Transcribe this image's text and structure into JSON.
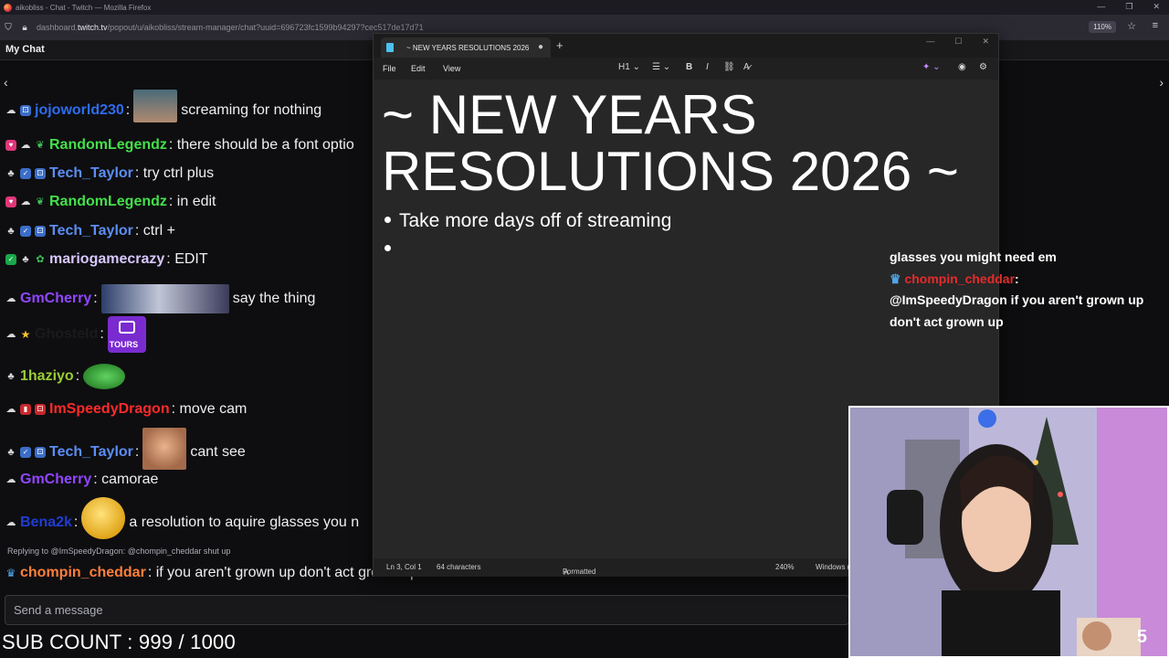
{
  "browser": {
    "window_title": "aikobliss - Chat - Twitch — Mozilla Firefox",
    "url_prefix": "dashboard.",
    "url_domain": "twitch.tv",
    "url_rest": "/popout/u/aikobliss/stream-manager/chat?uuid=696723fc1599b94297?cec517de17d71",
    "zoom": "110%"
  },
  "chat": {
    "header_title": "My Chat",
    "messages": [
      {
        "user": "jojoworld230",
        "color": "#2e6df0",
        "sep": ":",
        "text": "screaming for nothing"
      },
      {
        "user": "RandomLegendz",
        "color": "#44e04a",
        "sep": ":",
        "text": "there should be a font optio"
      },
      {
        "user": "Tech_Taylor",
        "color": "#5b8ef5",
        "sep": ":",
        "text": "try ctrl plus"
      },
      {
        "user": "RandomLegendz",
        "color": "#44e04a",
        "sep": ":",
        "text": "in edit"
      },
      {
        "user": "Tech_Taylor",
        "color": "#5b8ef5",
        "sep": ":",
        "text": "ctrl +"
      },
      {
        "user": "mariogamecrazy",
        "color": "#d8c7ff",
        "sep": ":",
        "text": "EDIT"
      },
      {
        "user": "GmCherry",
        "color": "#9146ff",
        "sep": ":",
        "text": "say the thing"
      },
      {
        "user": "Ghosteld",
        "color": "#1a1a1a",
        "sep": ":",
        "text": "",
        "emote_label": "TOURS"
      },
      {
        "user": "1haziyo",
        "color": "#9acd32",
        "sep": ":",
        "text": ""
      },
      {
        "user": "ImSpeedyDragon",
        "color": "#ff2a2a",
        "sep": ":",
        "text": "move cam"
      },
      {
        "user": "Tech_Taylor",
        "color": "#5b8ef5",
        "sep": ":",
        "text": "cant see"
      },
      {
        "user": "GmCherry",
        "color": "#9146ff",
        "sep": ":",
        "text": "camorae"
      },
      {
        "user": "Bena2k",
        "color": "#1e3dd6",
        "sep": ":",
        "text": "a resolution to aquire glasses you n"
      },
      {
        "user": "chompin_cheddar",
        "color": "#ff7f3a",
        "sep": ":",
        "text": "if you aren't grown up don't act grown up"
      }
    ],
    "reply_to": "Replying to @ImSpeedyDragon: @chompin_cheddar shut up",
    "input_placeholder": "Send a message"
  },
  "sub_count": "SUB COUNT : 999 / 1000",
  "notepad": {
    "tab_title": "~ NEW YEARS RESOLUTIONS 2026",
    "menu": [
      "File",
      "Edit",
      "View"
    ],
    "heading_tool": "H1",
    "heading": "~ NEW YEARS RESOLUTIONS 2026 ~",
    "bullets": [
      "Take more days off of streaming",
      ""
    ],
    "status": {
      "position": "Ln 3, Col 1",
      "chars": "64 characters",
      "format": "Formatted",
      "zoom": "240%",
      "eol": "Windows ("
    }
  },
  "overlay_chat": {
    "line1": "glasses you might need em",
    "user": "chompin_cheddar",
    "line2": "@ImSpeedyDragon if you aren't grown up don't act grown up"
  },
  "webcam": {
    "counter": "5"
  }
}
